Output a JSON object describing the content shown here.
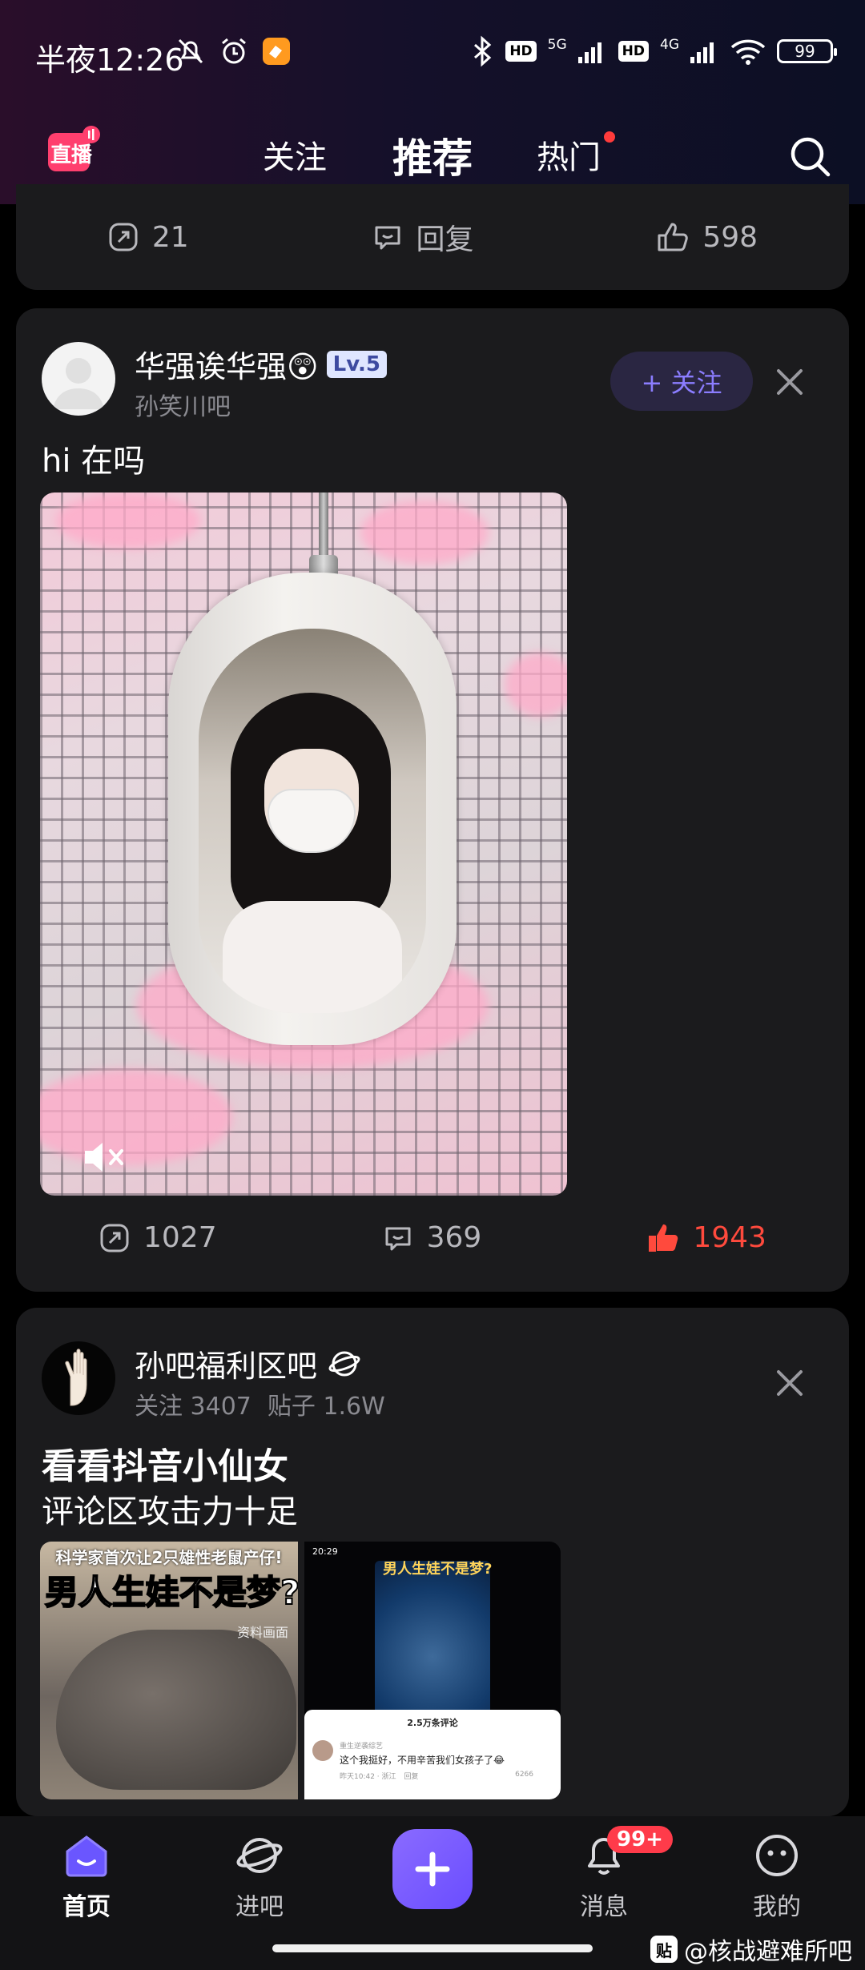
{
  "status_bar": {
    "time": "半夜12:26",
    "net1": "5G",
    "net2": "4G",
    "hd": "HD",
    "battery": "99"
  },
  "top_nav": {
    "logo_text": "直播",
    "tabs": [
      {
        "label": "关注",
        "active": false
      },
      {
        "label": "推荐",
        "active": true
      },
      {
        "label": "热门",
        "active": false,
        "has_dot": true
      }
    ]
  },
  "prev_card": {
    "shares": "21",
    "reply_label": "回复",
    "likes": "598"
  },
  "post": {
    "username": "华强诶华强😲",
    "level": "Lv.5",
    "forum": "孙笑川吧",
    "follow_label": "+ 关注",
    "text": "hi 在吗",
    "shares": "1027",
    "comments": "369",
    "likes": "1943",
    "liked": true
  },
  "forum_card": {
    "name": "孙吧福利区吧",
    "followers": "关注 3407",
    "posts": "贴子 1.6W",
    "title": "看看抖音小仙女",
    "subtitle": "评论区攻击力十足",
    "thumb1_top": "科学家首次让2只雄性老鼠产仔!",
    "thumb1_big": "男人生娃不是梦?",
    "thumb1_ref": "资料画面",
    "thumb2_status": "20:29",
    "thumb2_title": "男人生娃不是梦?",
    "comment_sheet_title": "2.5万条评论",
    "comment_user": "重生逆袭综艺",
    "comment_text": "这个我挺好，不用辛苦我们女孩子了😂",
    "comment_time": "昨天10:42 · 浙江",
    "comment_reply": "回复",
    "comment_likes": "6266"
  },
  "bottom_nav": {
    "items": [
      {
        "label": "首页",
        "active": true
      },
      {
        "label": "进吧",
        "active": false
      },
      {
        "label": "消息",
        "active": false,
        "badge": "99+"
      },
      {
        "label": "我的",
        "active": false
      }
    ]
  },
  "watermark": {
    "logo": "贴",
    "text": "@核战避难所吧"
  },
  "colors": {
    "accent": "#7b6cff",
    "like_red": "#ff4a3d",
    "card_bg": "#1b1b1d"
  }
}
